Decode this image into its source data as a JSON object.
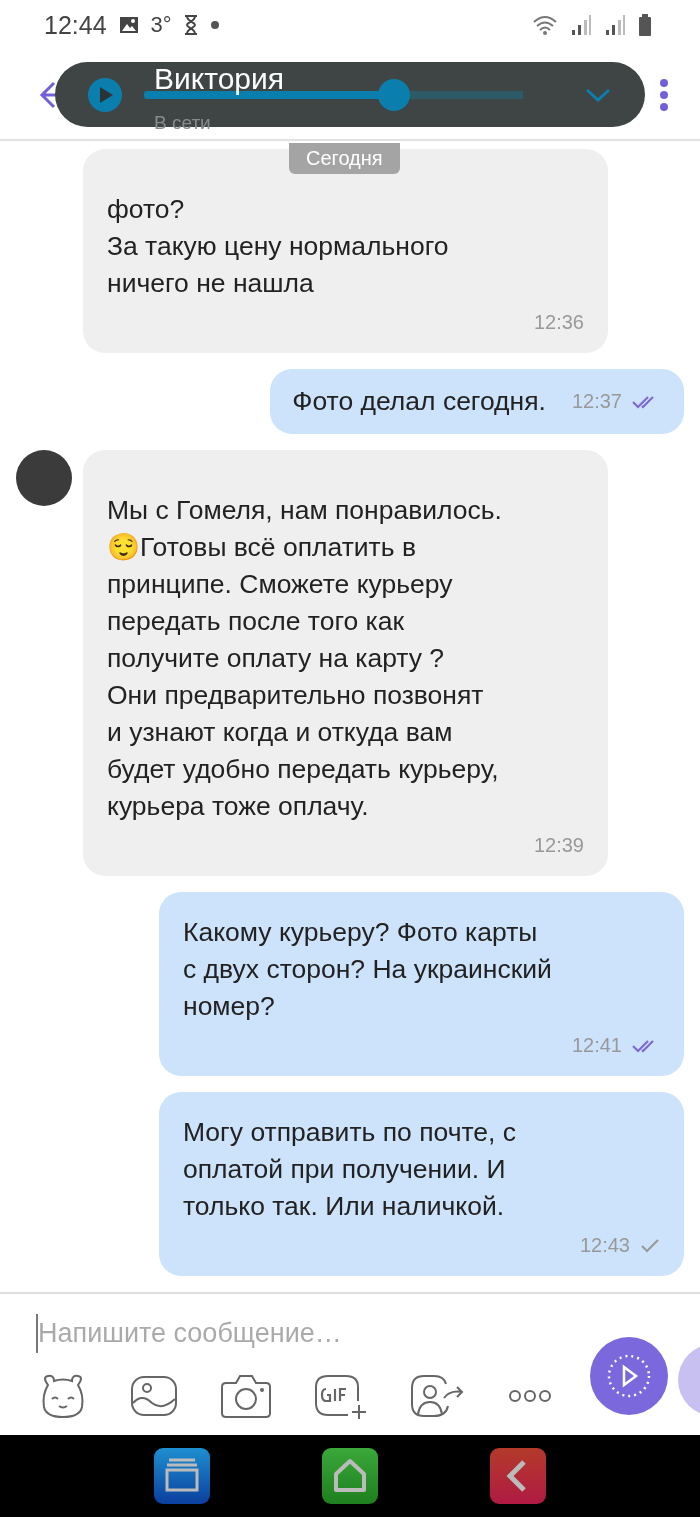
{
  "status_bar": {
    "time": "12:44",
    "temperature": "3°"
  },
  "header": {
    "name": "Виктория",
    "status": "В сети"
  },
  "player": {
    "level": 0.66
  },
  "date_chip": "Сегодня",
  "messages": [
    {
      "kind": "incoming",
      "avatar": false,
      "lines": [
        "фото?",
        "За такую цену нормального",
        "ничего не нашла"
      ],
      "time": "12:36"
    },
    {
      "kind": "outgoing",
      "lines": [
        "Фото делал сегодня."
      ],
      "time": "12:37",
      "read": true,
      "inline": true
    },
    {
      "kind": "incoming",
      "avatar": true,
      "lines": [
        "Мы с Гомеля, нам понравилось.",
        "😌Готовы всё оплатить в",
        "принципе. Сможете курьеру",
        "передать после того как",
        "получите оплату на карту ?",
        "Они предварительно позвонят",
        "и узнают когда и откуда вам",
        "будет удобно передать курьеру,",
        "курьера тоже оплачу."
      ],
      "time": "12:39"
    },
    {
      "kind": "outgoing",
      "lines": [
        "Какому курьеру? Фото карты",
        "с двух сторон? На украинский",
        "номер?"
      ],
      "time": "12:41",
      "read": true,
      "inline": false
    },
    {
      "kind": "outgoing",
      "lines": [
        "Могу отправить по почте, с",
        "оплатой при получении. И",
        "только так. Или наличкой."
      ],
      "time": "12:43",
      "read": false,
      "inline": false
    }
  ],
  "composer": {
    "placeholder": "Напишите сообщение…"
  }
}
